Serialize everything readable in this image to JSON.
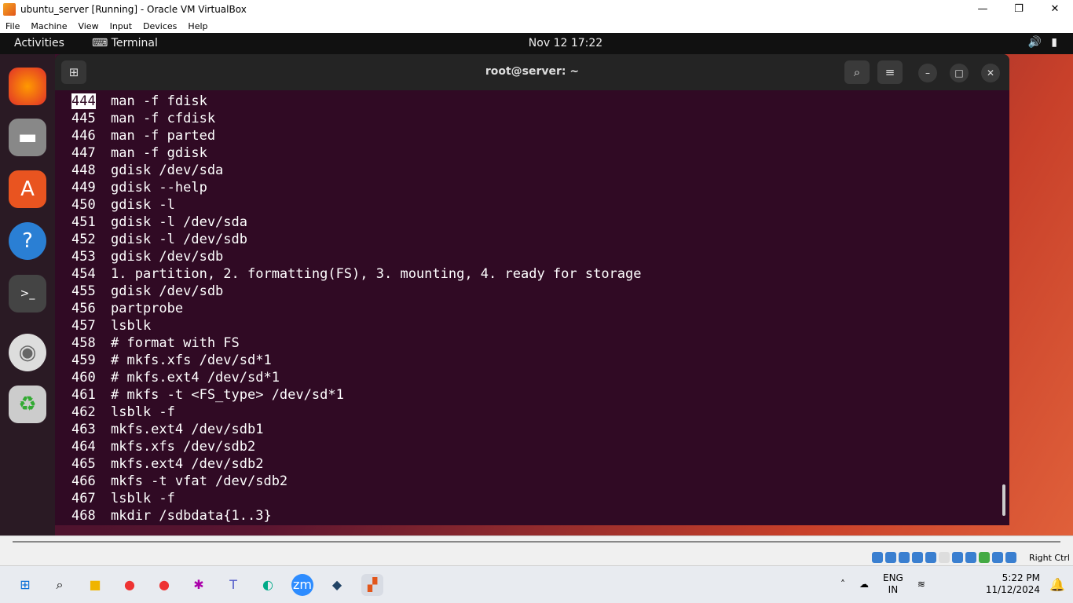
{
  "window": {
    "title": "ubuntu_server [Running] - Oracle VM VirtualBox",
    "controls": [
      "—",
      "❐",
      "✕"
    ]
  },
  "menu": [
    "File",
    "Machine",
    "View",
    "Input",
    "Devices",
    "Help"
  ],
  "gnome": {
    "activities": "Activities",
    "app": "Terminal",
    "clock": "Nov 12  17:22"
  },
  "terminal": {
    "title": "root@server: ~",
    "lines": [
      [
        "444",
        "man -f fdisk"
      ],
      [
        "445",
        "man -f cfdisk"
      ],
      [
        "446",
        "man -f parted"
      ],
      [
        "447",
        "man -f gdisk"
      ],
      [
        "448",
        "gdisk /dev/sda"
      ],
      [
        "449",
        "gdisk --help"
      ],
      [
        "450",
        "gdisk -l"
      ],
      [
        "451",
        "gdisk -l /dev/sda"
      ],
      [
        "452",
        "gdisk -l /dev/sdb"
      ],
      [
        "453",
        "gdisk /dev/sdb"
      ],
      [
        "454",
        "1. partition, 2. formatting(FS), 3. mounting, 4. ready for storage"
      ],
      [
        "455",
        "gdisk /dev/sdb"
      ],
      [
        "456",
        "partprobe"
      ],
      [
        "457",
        "lsblk"
      ],
      [
        "458",
        "# format with FS"
      ],
      [
        "459",
        "# mkfs.xfs /dev/sd*1"
      ],
      [
        "460",
        "# mkfs.ext4 /dev/sd*1"
      ],
      [
        "461",
        "# mkfs -t <FS_type> /dev/sd*1"
      ],
      [
        "462",
        "lsblk -f"
      ],
      [
        "463",
        "mkfs.ext4 /dev/sdb1"
      ],
      [
        "464",
        "mkfs.xfs /dev/sdb2"
      ],
      [
        "465",
        "mkfs.ext4 /dev/sdb2"
      ],
      [
        "466",
        "mkfs -t vfat /dev/sdb2"
      ],
      [
        "467",
        "lsblk -f"
      ],
      [
        "468",
        "mkdir /sdbdata{1..3}"
      ]
    ]
  },
  "vbox_status": {
    "host_key": "Right Ctrl"
  },
  "taskbar": {
    "lang1": "ENG",
    "lang2": "IN",
    "time": "5:22 PM",
    "date": "11/12/2024"
  }
}
